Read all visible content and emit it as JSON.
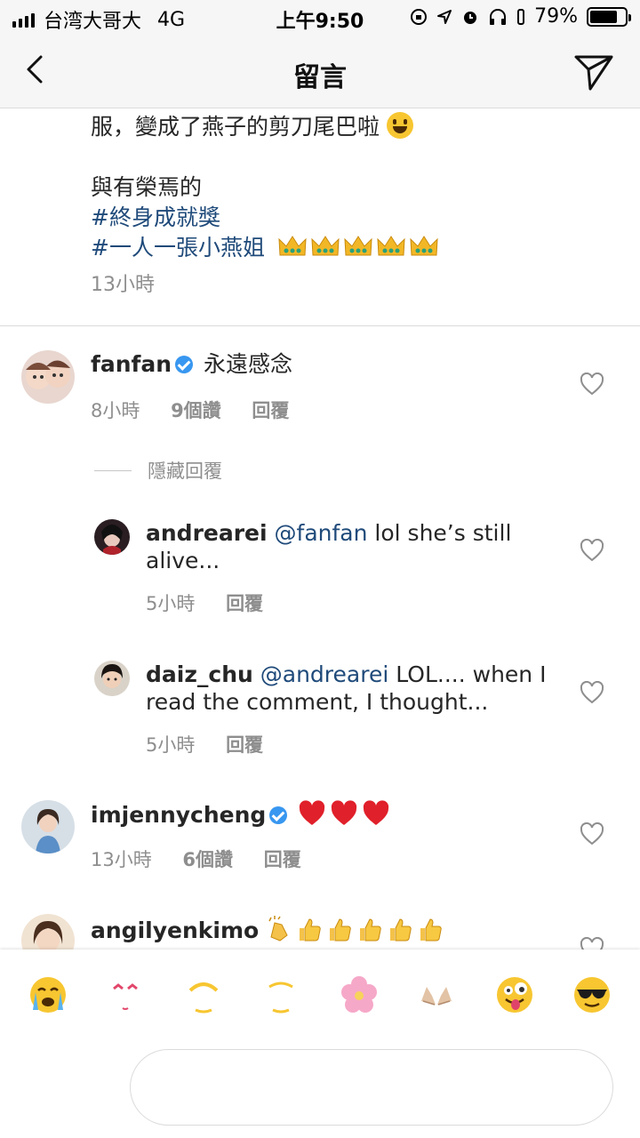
{
  "status_bar": {
    "carrier": "台湾大哥大",
    "network": "4G",
    "time": "上午9:50",
    "battery": "79%",
    "battery_level": 0.79
  },
  "header": {
    "title": "留言",
    "back_icon": "chevron-left-icon",
    "send_icon": "paper-plane-icon"
  },
  "caption": {
    "line1": "服，變成了燕子的剪刀尾巴啦",
    "line2": "與有榮焉的",
    "hashtag1": "#終身成就獎",
    "hashtag2": "#一人一張小燕姐",
    "crown_count": 5,
    "time": "13小時"
  },
  "comments": [
    {
      "user": "fanfan",
      "verified": true,
      "text": "永遠感念",
      "time": "8小時",
      "likes": "9個讚",
      "reply": "回覆"
    },
    {
      "user": "andrearei",
      "mention": "@fanfan",
      "text": "lol she’s still",
      "text2": "alive...",
      "time": "5小時",
      "reply": "回覆"
    },
    {
      "user": "daiz_chu",
      "mention": "@andrearei",
      "text": "LOL.... when I",
      "text2": "read the comment, I thought...",
      "time": "5小時",
      "reply": "回覆"
    },
    {
      "user": "imjennycheng",
      "verified": true,
      "time": "13小時",
      "likes": "6個讚",
      "reply": "回覆"
    },
    {
      "user": "angilyenkimo"
    }
  ],
  "hidden_replies": "隱藏回覆",
  "emoji_bar": {
    "emojis": [
      "crying-face",
      "heart-eyes-face",
      "smiling-face",
      "smiling-face",
      "cherry-blossom",
      "raising-hands",
      "zany-face",
      "sunglasses-face"
    ]
  },
  "reply_input": {
    "value": "",
    "placeholder": ""
  },
  "colors": {
    "link": "#1f4a7a",
    "muted": "#8e8e8e",
    "verified": "#3897f0",
    "heart_red": "#e0202a"
  }
}
